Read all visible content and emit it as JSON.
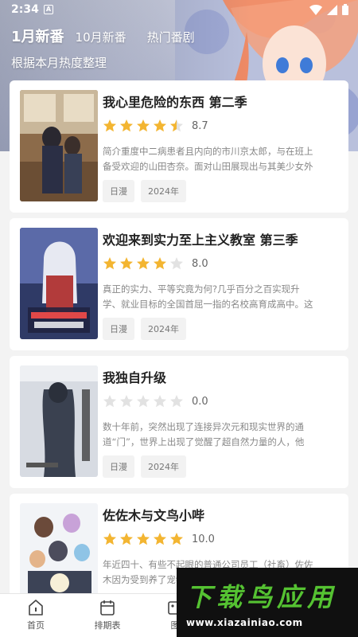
{
  "status": {
    "time": "2:34",
    "app_badge": "A"
  },
  "tabs": [
    {
      "label": "1月新番"
    },
    {
      "label": "10月新番"
    },
    {
      "label": "热门番剧"
    }
  ],
  "subtitle": "根据本月热度整理",
  "anime": [
    {
      "title": "我心里危险的东西 第二季",
      "rating_stars": 4.5,
      "score": "8.7",
      "description": "简介重度中二病患者且内向的市川京太郎，与在班上备受欢迎的山田杏奈。面对山田展现出与其美少女外表…",
      "tags": [
        "日漫",
        "2024年"
      ]
    },
    {
      "title": "欢迎来到实力至上主义教室 第三季",
      "rating_stars": 4,
      "score": "8.0",
      "description": "真正的实力、平等究竟为何?几乎百分之百实现升学、就业目标的全国首屈一指的名校高育成高中。这间…",
      "tags": [
        "日漫",
        "2024年"
      ]
    },
    {
      "title": "我独自升级",
      "rating_stars": 0,
      "score": "0.0",
      "description": "数十年前，突然出现了连接异次元和现实世界的通道“门”，世界上出现了觉醒了超自然力量的人，他们…",
      "tags": [
        "日漫",
        "2024年"
      ]
    },
    {
      "title": "佐佐木与文鸟小哔",
      "rating_stars": 5,
      "score": "10.0",
      "description": "年近四十、有些不起眼的普通公司员工（社畜）佐佐木因为受到养了宠物",
      "tags": []
    }
  ],
  "bottom_nav": [
    {
      "label": "首页",
      "icon": "home-icon"
    },
    {
      "label": "排期表",
      "icon": "calendar-icon"
    },
    {
      "label": "图",
      "icon": "image-icon"
    }
  ],
  "watermark": {
    "title": "下载鸟应用",
    "url": "www.xiazainiao.com"
  },
  "colors": {
    "star": "#f3b531",
    "star_empty": "#e2e2e2",
    "watermark_green": "#55c232"
  }
}
